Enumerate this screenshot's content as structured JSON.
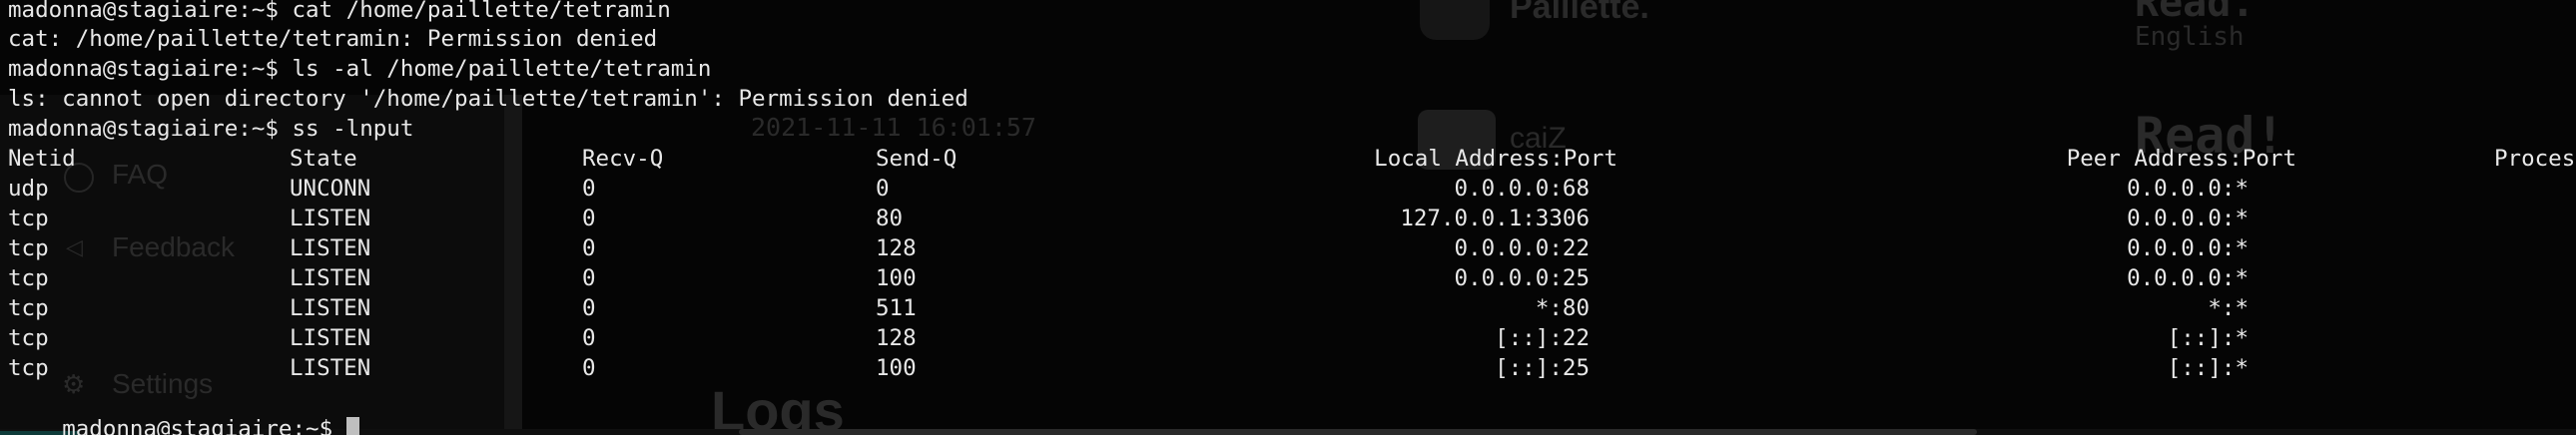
{
  "terminal": {
    "lines": [
      "madonna@stagiaire:~$ cat /home/paillette/tetramin",
      "cat: /home/paillette/tetramin: Permission denied",
      "madonna@stagiaire:~$ ls -al /home/paillette/tetramin",
      "ls: cannot open directory '/home/paillette/tetramin': Permission denied",
      "madonna@stagiaire:~$ ss -lnput"
    ],
    "prompt": "madonna@stagiaire:~$",
    "table": {
      "headers": {
        "netid": "Netid",
        "state": "State",
        "recvq": "Recv-Q",
        "sendq": "Send-Q",
        "local": "Local Address:Port",
        "peer": "Peer Address:Port",
        "process": "Proces"
      },
      "rows": [
        {
          "netid": "udp",
          "state": "UNCONN",
          "recvq": "0",
          "sendq": "0",
          "local": "0.0.0.0:68",
          "peer": "0.0.0.0:*"
        },
        {
          "netid": "tcp",
          "state": "LISTEN",
          "recvq": "0",
          "sendq": "80",
          "local": "127.0.0.1:3306",
          "peer": "0.0.0.0:*"
        },
        {
          "netid": "tcp",
          "state": "LISTEN",
          "recvq": "0",
          "sendq": "128",
          "local": "0.0.0.0:22",
          "peer": "0.0.0.0:*"
        },
        {
          "netid": "tcp",
          "state": "LISTEN",
          "recvq": "0",
          "sendq": "100",
          "local": "0.0.0.0:25",
          "peer": "0.0.0.0:*"
        },
        {
          "netid": "tcp",
          "state": "LISTEN",
          "recvq": "0",
          "sendq": "511",
          "local": "*:80",
          "peer": "*:*"
        },
        {
          "netid": "tcp",
          "state": "LISTEN",
          "recvq": "0",
          "sendq": "128",
          "local": "[::]:22",
          "peer": "[::]:*"
        },
        {
          "netid": "tcp",
          "state": "LISTEN",
          "recvq": "0",
          "sendq": "100",
          "local": "[::]:25",
          "peer": "[::]:*"
        }
      ]
    }
  },
  "background": {
    "sidebar_items": [
      "FAQ",
      "Feedback",
      "Settings"
    ],
    "timestamp": "2021-11-11 16:01:57",
    "heading_logs": "Logs",
    "heading_read": "Read!",
    "language": "English",
    "top_name": "Paillette.",
    "top_right": "Read.",
    "user_short": "caiZ",
    "icon_names": [
      "question-icon",
      "speaker-icon",
      "gear-icon"
    ],
    "colors": {
      "terminal_bg": "#050505",
      "text": "#e8e8e8",
      "cursor": "#bfbfbf",
      "ghost": "#2a2a2a"
    }
  }
}
